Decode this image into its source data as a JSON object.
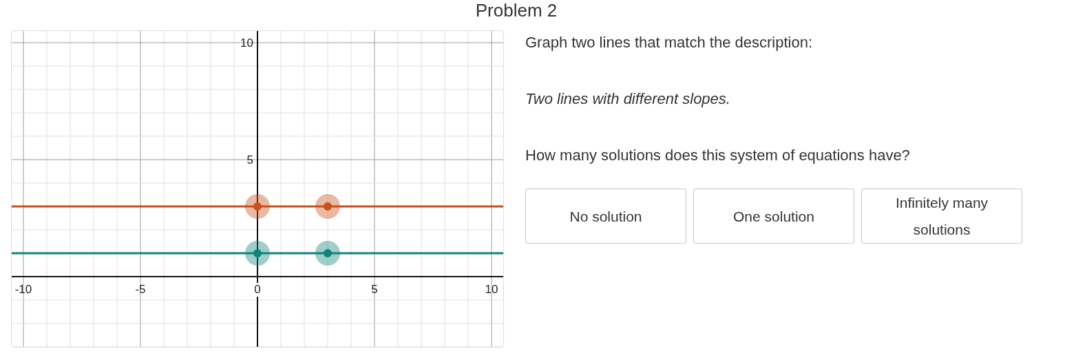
{
  "title": "Problem 2",
  "graph": {
    "chart_data": {
      "type": "line",
      "x": [
        -10.5,
        0,
        3,
        10.5
      ],
      "xlim": [
        -10.5,
        10.5
      ],
      "ylim": [
        -3,
        10.5
      ],
      "xticks": [
        -10,
        -5,
        0,
        5,
        10
      ],
      "yticks": [
        5,
        10
      ],
      "grid": true,
      "series": [
        {
          "color": "#c94f1c",
          "marker": "circle",
          "values": [
            3,
            3,
            3,
            3
          ]
        },
        {
          "color": "#0f847a",
          "marker": "circle",
          "values": [
            1,
            1,
            1,
            1
          ]
        }
      ]
    }
  },
  "prompt": "Graph two lines that match the description:",
  "description": "Two lines with different slopes.",
  "question": "How many solutions does this system of equations have?",
  "answers": [
    {
      "label": "No solution",
      "selected": false
    },
    {
      "label": "One solution",
      "selected": false
    },
    {
      "label": "Infinitely many solutions",
      "selected": false
    }
  ]
}
